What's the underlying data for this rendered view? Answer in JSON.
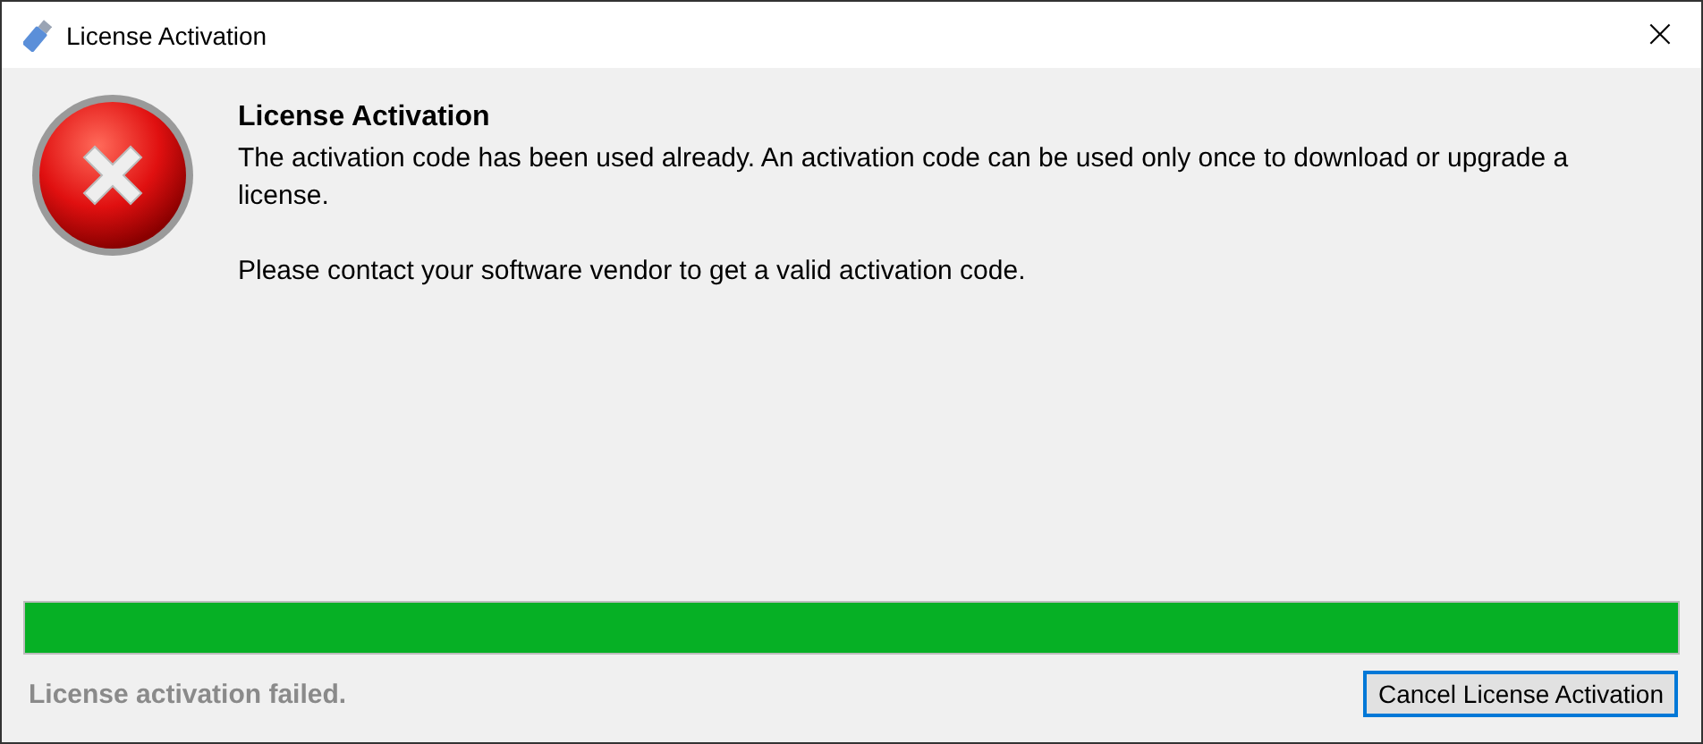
{
  "window": {
    "title": "License Activation",
    "close": "×"
  },
  "message": {
    "heading": "License Activation",
    "paragraphs": [
      "The activation code has been used already. An activation code can be used only once to download or upgrade a license.",
      "Please contact your software vendor to get a valid activation code."
    ]
  },
  "progress": {
    "level": 1
  },
  "status": "License activation failed.",
  "buttons": [
    {
      "label": "Cancel License Activation",
      "selected": true
    }
  ]
}
